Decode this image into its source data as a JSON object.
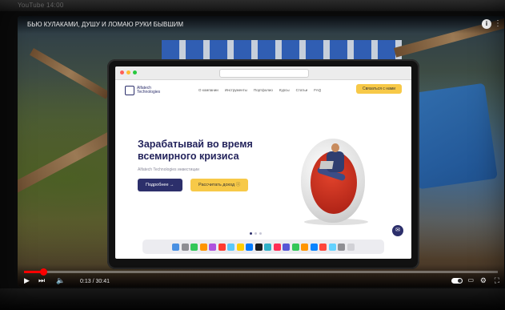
{
  "photo": {
    "top_caption": "YouTube 14:00"
  },
  "player": {
    "title": "БЬЮ КУЛАКАМИ, ДУШУ И ЛОМАЮ РУКИ БЫВШИМ",
    "info_icon": "info-icon",
    "menu_icon": "more-vert-icon",
    "progress": 0.04,
    "time_text": "0:13 / 30:41",
    "controls": {
      "play_icon": "play-icon",
      "next_icon": "next-icon",
      "volume_icon": "volume-icon",
      "autoplay_toggle": "autoplay-toggle",
      "subtitles_icon": "subtitles-icon",
      "settings_icon": "settings-icon",
      "fullscreen_icon": "fullscreen-icon"
    }
  },
  "website": {
    "logo_text": "Alfatech Technologies",
    "nav_links": [
      "О компании",
      "Инструменты",
      "Портфолио",
      "Курсы",
      "Статьи",
      "FAQ"
    ],
    "nav_cta": "Связаться с нами",
    "hero_title": "Зарабатывай во время всемирного кризиса",
    "hero_subtitle": "Alfatech Technologies инвестиции",
    "btn_more": "Подробнее →",
    "btn_calc": "Рассчитать доход ⓘ",
    "chat_icon": "chat-icon"
  },
  "colors": {
    "brand_navy": "#2c2f6b",
    "accent_yellow": "#f7c948",
    "progress_red": "#ff0000"
  }
}
